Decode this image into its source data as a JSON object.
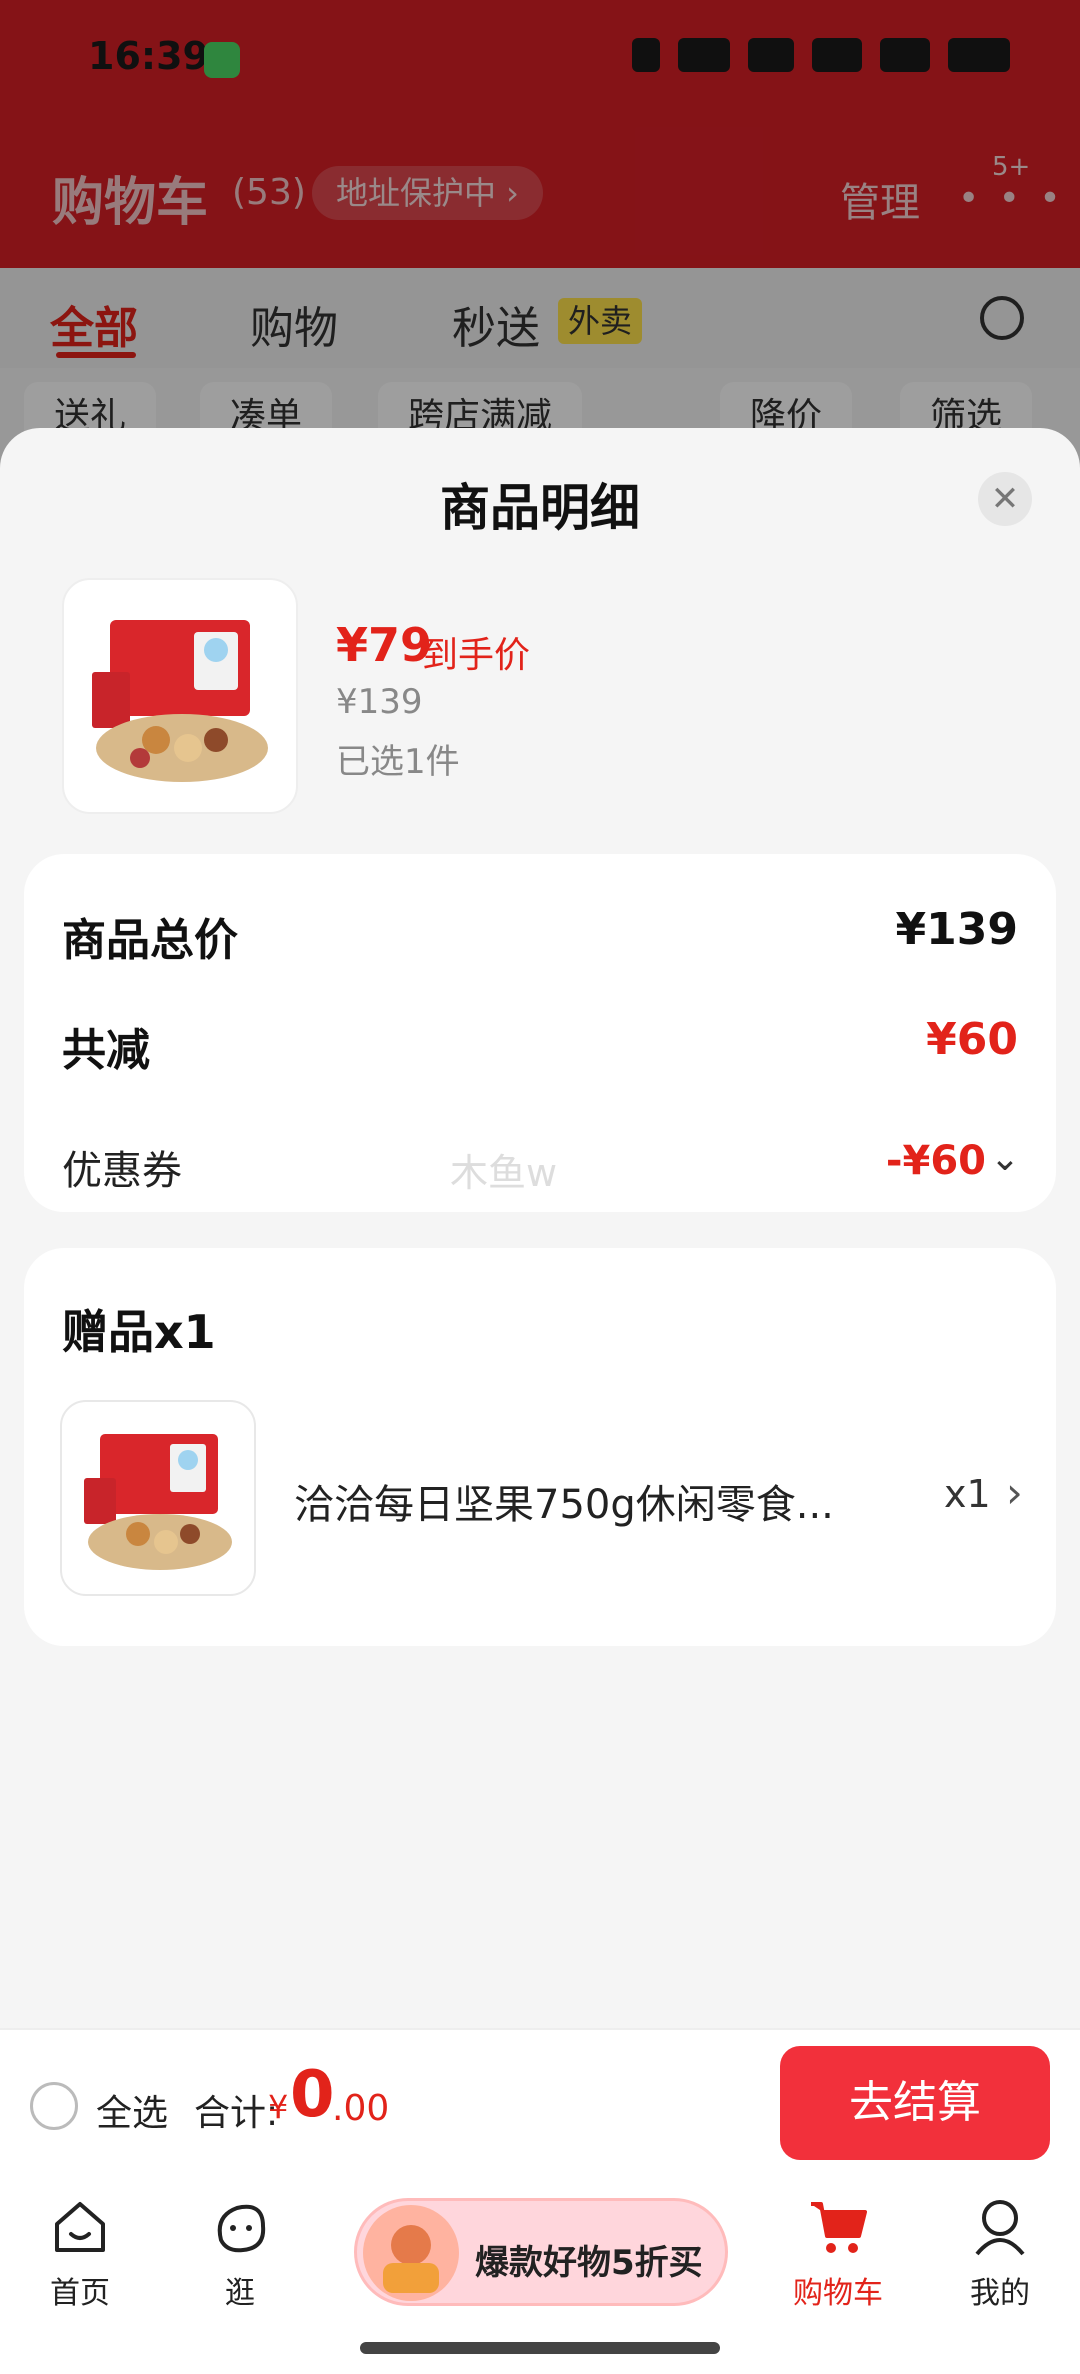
{
  "status_bar": {
    "time": "16:39"
  },
  "cart": {
    "title": "购物车",
    "count": "(53)",
    "address_protect": "地址保护中 ›",
    "manage": "管理",
    "more_badge": "5+",
    "tabs": [
      "全部",
      "购物",
      "秒送"
    ],
    "waimai_badge": "外卖",
    "chips": [
      "送礼",
      "凑单",
      "跨店满减",
      "降价",
      "筛选"
    ]
  },
  "sheet": {
    "title": "商品明细",
    "product": {
      "price": "¥79",
      "price_tag": "到手价",
      "original_price": "¥139",
      "selected": "已选1件"
    },
    "summary": {
      "total_label": "商品总价",
      "total_value": "¥139",
      "discount_label": "共减",
      "discount_value": "¥60",
      "coupon_label": "优惠券",
      "coupon_value": "-¥60",
      "watermark": "木鱼w"
    },
    "gift": {
      "title": "赠品x1",
      "name": "洽洽每日坚果750g休闲零食...",
      "qty": "x1"
    }
  },
  "checkout": {
    "select_all": "全选",
    "total_label": "合计:",
    "currency": "¥",
    "total_int": "0",
    "total_dec": ".00",
    "button": "去结算"
  },
  "tabbar": {
    "items": [
      {
        "label": "首页"
      },
      {
        "label": "逛"
      },
      {
        "label": "购物车"
      },
      {
        "label": "我的"
      }
    ],
    "promo": "爆款好物5折买"
  },
  "colors": {
    "accent": "#e2231a",
    "header_red": "#d71f26",
    "button_red": "#f2303b"
  }
}
